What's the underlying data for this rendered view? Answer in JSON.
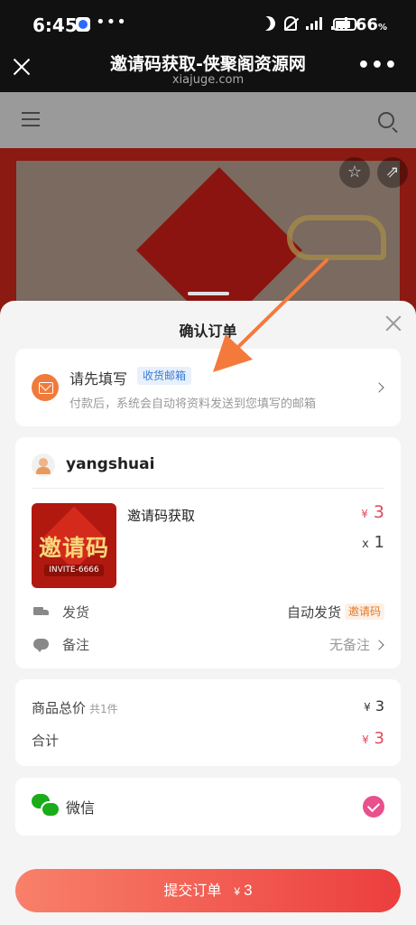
{
  "status_bar": {
    "time": "6:45",
    "dots": "•••",
    "battery": "66",
    "battery_unit": "%"
  },
  "browser": {
    "title": "邀请码获取-侠聚阁资源网",
    "domain": "xiajuge.com"
  },
  "sheet": {
    "title": "确认订单",
    "email_card": {
      "label": "请先填写",
      "tag": "收货邮箱",
      "hint": "付款后，系统会自动将资料发送到您填写的邮箱"
    },
    "product_card": {
      "seller": "yangshuai",
      "thumbnail_main": "邀请码",
      "thumbnail_sub": "INVITE-6666",
      "product_name": "邀请码获取",
      "currency": "¥",
      "price": "3",
      "qty_prefix": "x",
      "qty": "1",
      "shipping_label": "发货",
      "shipping_value": "自动发货",
      "shipping_tag": "邀请码",
      "note_label": "备注",
      "note_value": "无备注"
    },
    "totals": {
      "subtotal_label": "商品总价",
      "subtotal_count": "共1件",
      "subtotal_currency": "¥",
      "subtotal": "3",
      "total_label": "合计",
      "total_currency": "¥",
      "total": "3"
    },
    "payment": {
      "method": "微信"
    },
    "submit": {
      "label": "提交订单",
      "currency": "¥",
      "amount": "3"
    }
  },
  "colors": {
    "accent_red": "#e04a5a",
    "submit_gradient_start": "#f8806a",
    "submit_gradient_end": "#ec3e3e",
    "arrow_orange": "#f47a3c",
    "wechat_green": "#1aad19",
    "check_pink": "#e8508e"
  },
  "icons": [
    "close-icon",
    "more-icon",
    "menu-icon",
    "search-icon",
    "star-icon",
    "share-icon",
    "mail-icon",
    "avatar",
    "truck-icon",
    "comment-icon",
    "wechat-icon",
    "check-icon",
    "chevron-right-icon"
  ]
}
